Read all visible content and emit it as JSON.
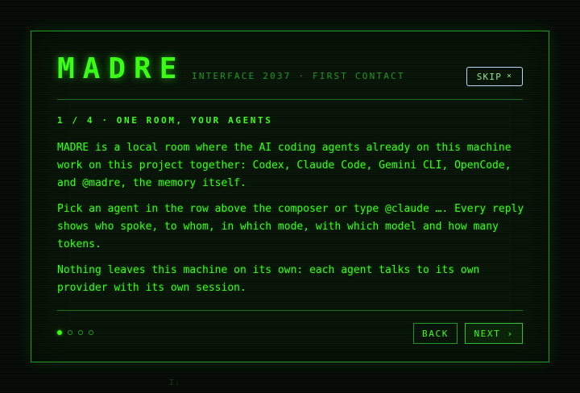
{
  "header": {
    "brand": "MADRE",
    "subtitle": "INTERFACE 2037 · FIRST CONTACT",
    "skip_label": "SKIP",
    "skip_icon": "close-icon"
  },
  "step": {
    "title": "1 / 4 · ONE ROOM, YOUR AGENTS",
    "current": 1,
    "total": 4
  },
  "content": {
    "paragraphs": [
      "MADRE is a local room where the AI coding agents already on this machine work on this project together: Codex, Claude Code, Gemini CLI, OpenCode, and @madre, the memory itself.",
      "Pick an agent in the row above the composer or type @claude …. Every reply shows who spoke, to whom, in which mode, with which model and how many tokens.",
      "Nothing leaves this machine on its own: each agent talks to its own provider with its own session."
    ]
  },
  "footer": {
    "back_label": "BACK",
    "next_label": "NEXT",
    "next_icon": "chevron-right-icon"
  },
  "background": {
    "hint": "I:"
  },
  "colors": {
    "accent": "#39ff14",
    "accent_dim": "#1f9a1f",
    "background": "#050a05",
    "panel": "#081208",
    "skip_border": "#b9d8ff"
  }
}
